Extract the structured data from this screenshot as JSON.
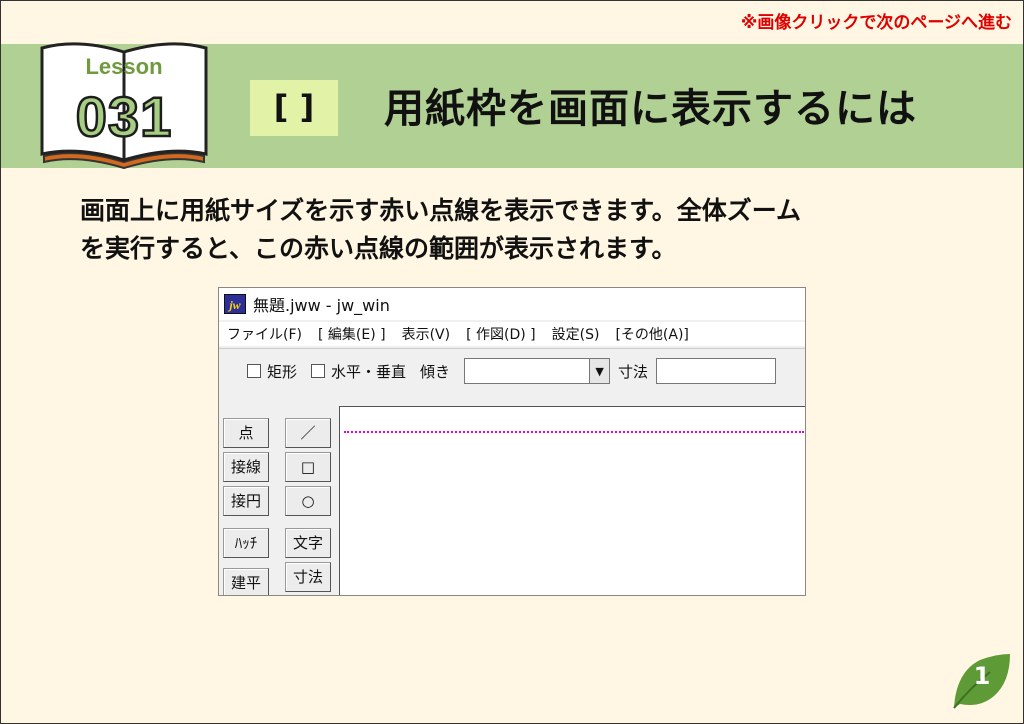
{
  "page_hint": "※画像クリックで次のページへ進む",
  "lesson": {
    "label": "Lesson",
    "number": "031"
  },
  "title_bracket": "[ ]",
  "title": "用紙枠を画面に表示するには",
  "description": [
    "画面上に用紙サイズを示す赤い点線を表示できます。全体ズーム",
    "を実行すると、この赤い点線の範囲が表示されます。"
  ],
  "app": {
    "icon_text": "jw",
    "window_title": "無題.jww - jw_win",
    "menu": [
      "ファイル(F)",
      "[ 編集(E) ]",
      "表示(V)",
      "[ 作図(D) ]",
      "設定(S)",
      "[その他(A)]"
    ],
    "toolbar": {
      "rect_label": "矩形",
      "hv_label": "水平・垂直",
      "angle_label": "傾き",
      "dim_label": "寸法"
    },
    "left_tools_col1": [
      "点",
      "接線",
      "接円",
      "ﾊｯﾁ",
      "建平"
    ],
    "left_tools_col2": [
      "／",
      "□",
      "○",
      "文字",
      "寸法"
    ]
  },
  "page_number": "1",
  "colors": {
    "band": "#b1d094",
    "hint_red": "#e00000",
    "paper_frame_dots": "#e000e0",
    "leaf_green": "#5e9a36"
  }
}
